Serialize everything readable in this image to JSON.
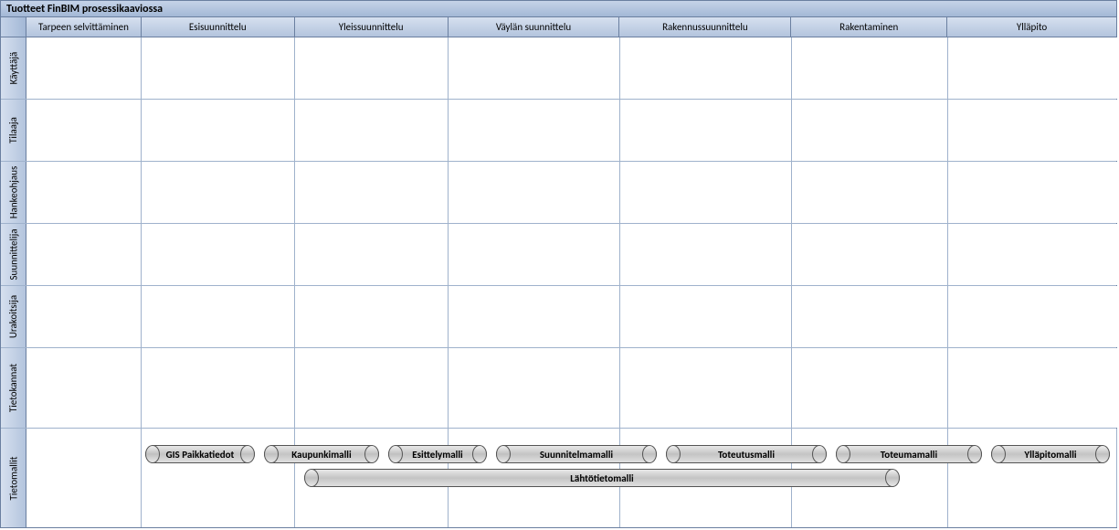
{
  "title": "Tuotteet FinBIM prosessikaaviossa",
  "columns": [
    "Tarpeen selvittäminen",
    "Esisuunnittelu",
    "Yleissuunnittelu",
    "Väylän suunnittelu",
    "Rakennussuunnittelu",
    "Rakentaminen",
    "Ylläpito"
  ],
  "lanes": [
    "Käyttäjä",
    "Tilaaja",
    "Hankeohjaus",
    "Suunnittelija",
    "Urakoitsija",
    "Tietokannat",
    "Tietomallit"
  ],
  "cylinders": {
    "gis": "GIS Paikkatiedot",
    "kaupunki": "Kaupunkimalli",
    "esittely": "Esittelymalli",
    "suunnitelma": "Suunnitelmamalli",
    "toteutus": "Toteutusmalli",
    "toteuma": "Toteumamalli",
    "yllapito": "Ylläpitomalli",
    "lahtotieto": "Lähtötietomalli"
  }
}
